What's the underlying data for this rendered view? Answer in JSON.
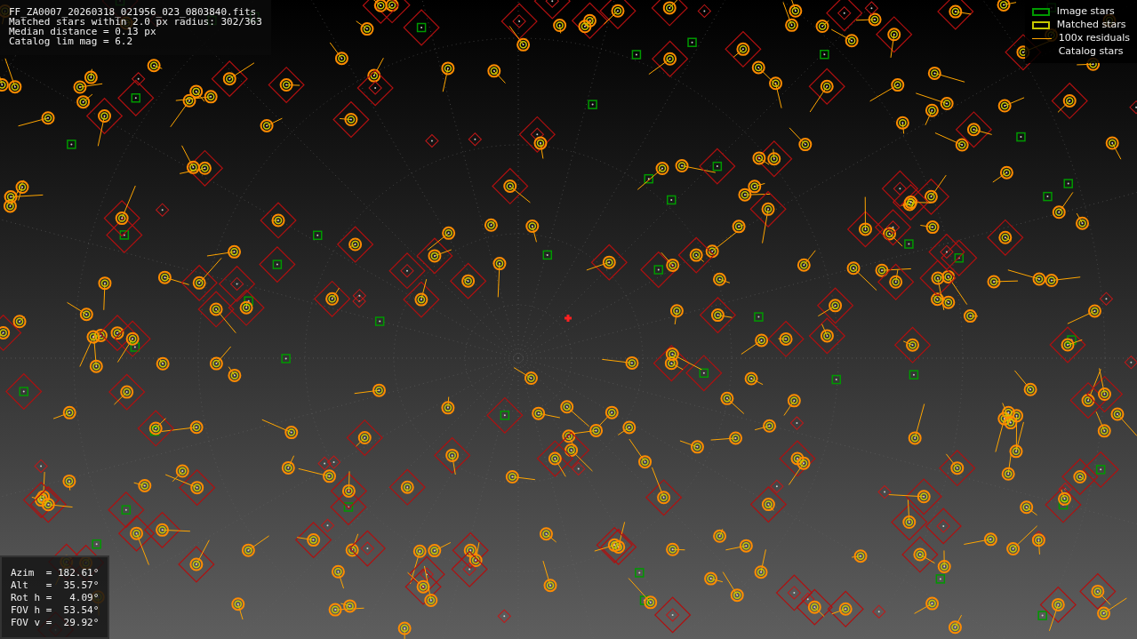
{
  "file_info": {
    "lines": [
      "FF_ZA0007_20260318_021956_023_0803840.fits",
      "Matched stars within 2.0 px radius: 302/363",
      "Median distance = 0.13 px",
      "Catalog lim mag = 6.2"
    ]
  },
  "legend": [
    {
      "label": "Image stars",
      "kind": "box",
      "color": "#009900"
    },
    {
      "label": "Matched stars",
      "kind": "box",
      "color": "#c8c800"
    },
    {
      "label": "100x residuals",
      "kind": "line",
      "color": "#ffa500"
    },
    {
      "label": "Catalog stars",
      "kind": "blank"
    }
  ],
  "pointing": {
    "lines": [
      "Azim  = 182.61°",
      "Alt   =  35.57°",
      "Rot h =   4.09°",
      "FOV h =  53.54°",
      "FOV v =  29.92°"
    ]
  }
}
